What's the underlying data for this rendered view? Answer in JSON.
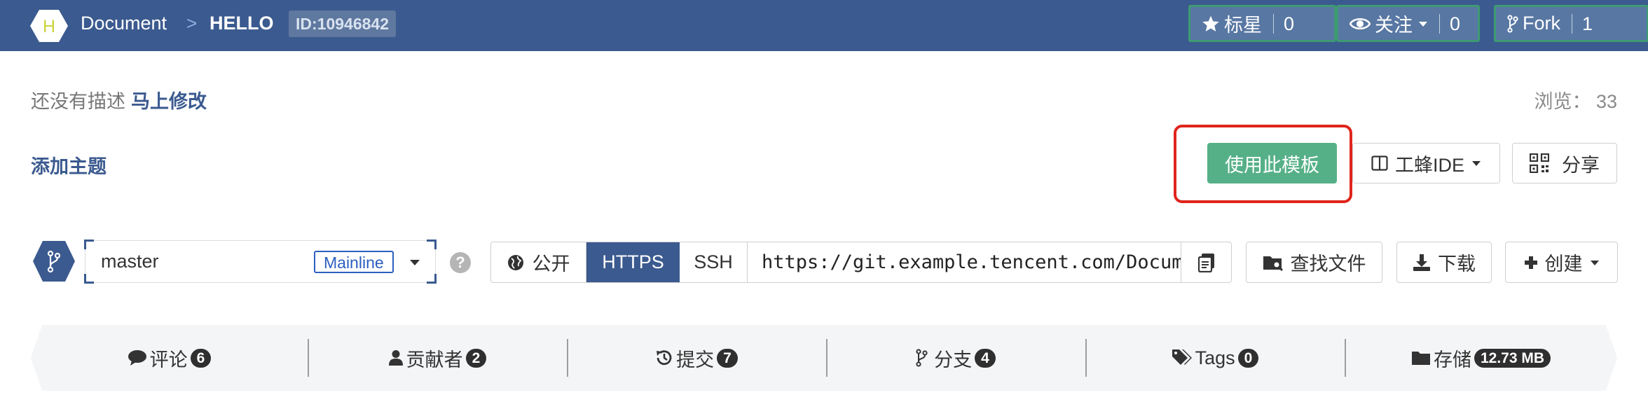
{
  "header": {
    "project_initial": "H",
    "breadcrumb_project": "Document",
    "breadcrumb_separator": ">",
    "breadcrumb_repo": "HELLO",
    "repo_id": "ID:10946842",
    "star": {
      "label": "标星",
      "count": "0"
    },
    "watch": {
      "label": "关注",
      "count": "0"
    },
    "fork": {
      "label": "Fork",
      "count": "1"
    }
  },
  "description": {
    "empty_text": "还没有描述",
    "edit_link": "马上修改",
    "views": "浏览： 33"
  },
  "topic": {
    "add_label": "添加主题"
  },
  "actions": {
    "use_template": "使用此模板",
    "ide": "工蜂IDE",
    "share": "分享"
  },
  "branch": {
    "name": "master",
    "tag": "Mainline"
  },
  "clone": {
    "visibility": "公开",
    "https": "HTTPS",
    "ssh": "SSH",
    "url": "https://git.example.tencent.com/Document/HELLO.git"
  },
  "toolbar": {
    "find_file": "查找文件",
    "download": "下载",
    "create": "创建"
  },
  "stats": [
    {
      "icon": "comment-icon",
      "label": "评论",
      "count": "6"
    },
    {
      "icon": "user-icon",
      "label": "贡献者",
      "count": "2"
    },
    {
      "icon": "history-icon",
      "label": "提交",
      "count": "7"
    },
    {
      "icon": "branch-icon",
      "label": "分支",
      "count": "4"
    },
    {
      "icon": "tag-icon",
      "label": "Tags",
      "count": "0"
    },
    {
      "icon": "folder-icon",
      "label": "存储",
      "count": "12.73 MB"
    }
  ],
  "colors": {
    "topbar": "#3b5a8f",
    "template_button": "#56b087",
    "highlight": "#e0241b"
  }
}
